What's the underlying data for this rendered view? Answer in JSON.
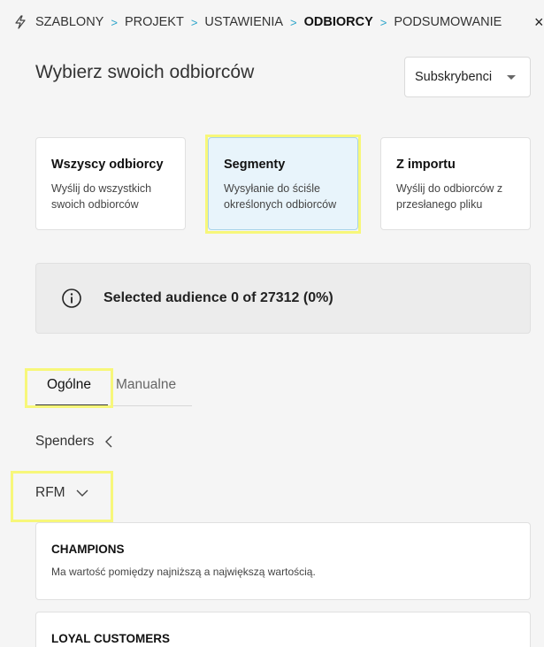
{
  "breadcrumb": {
    "items": [
      "SZABLONY",
      "PROJEKT",
      "USTAWIENIA",
      "ODBIORCY",
      "PODSUMOWANIE"
    ],
    "separator": ">",
    "active_index": 3,
    "icon": "bolt-icon"
  },
  "close_label": "×",
  "page_title": "Wybierz swoich odbiorców",
  "audience_select": {
    "selected": "Subskrybenci"
  },
  "audience_options": [
    {
      "title": "Wszyscy odbiorcy",
      "desc_line1": "Wyślij do wszystkich",
      "desc_line2": "swoich odbiorców",
      "selected": false
    },
    {
      "title": "Segmenty",
      "desc_line1": "Wysyłanie do ściśle",
      "desc_line2": "określonych odbiorców",
      "selected": true
    },
    {
      "title": "Z importu",
      "desc_line1": "Wyślij do odbiorców z",
      "desc_line2": "przesłanego pliku",
      "selected": false
    }
  ],
  "info": {
    "text": "Selected audience 0 of 27312 (0%)",
    "icon": "info-icon"
  },
  "tabs": [
    {
      "label": "Ogólne",
      "active": true
    },
    {
      "label": "Manualne",
      "active": false
    }
  ],
  "groups": [
    {
      "label": "Spenders",
      "state": "collapsed"
    },
    {
      "label": "RFM",
      "state": "expanded"
    }
  ],
  "segments": [
    {
      "title": "CHAMPIONS",
      "desc": "Ma wartość pomiędzy najniższą a największą wartością."
    },
    {
      "title": "LOYAL CUSTOMERS",
      "desc": ""
    }
  ],
  "colors": {
    "accent": "#29a3c9",
    "highlight": "#f7f77a",
    "selected_card_bg": "#e8f4fb"
  }
}
